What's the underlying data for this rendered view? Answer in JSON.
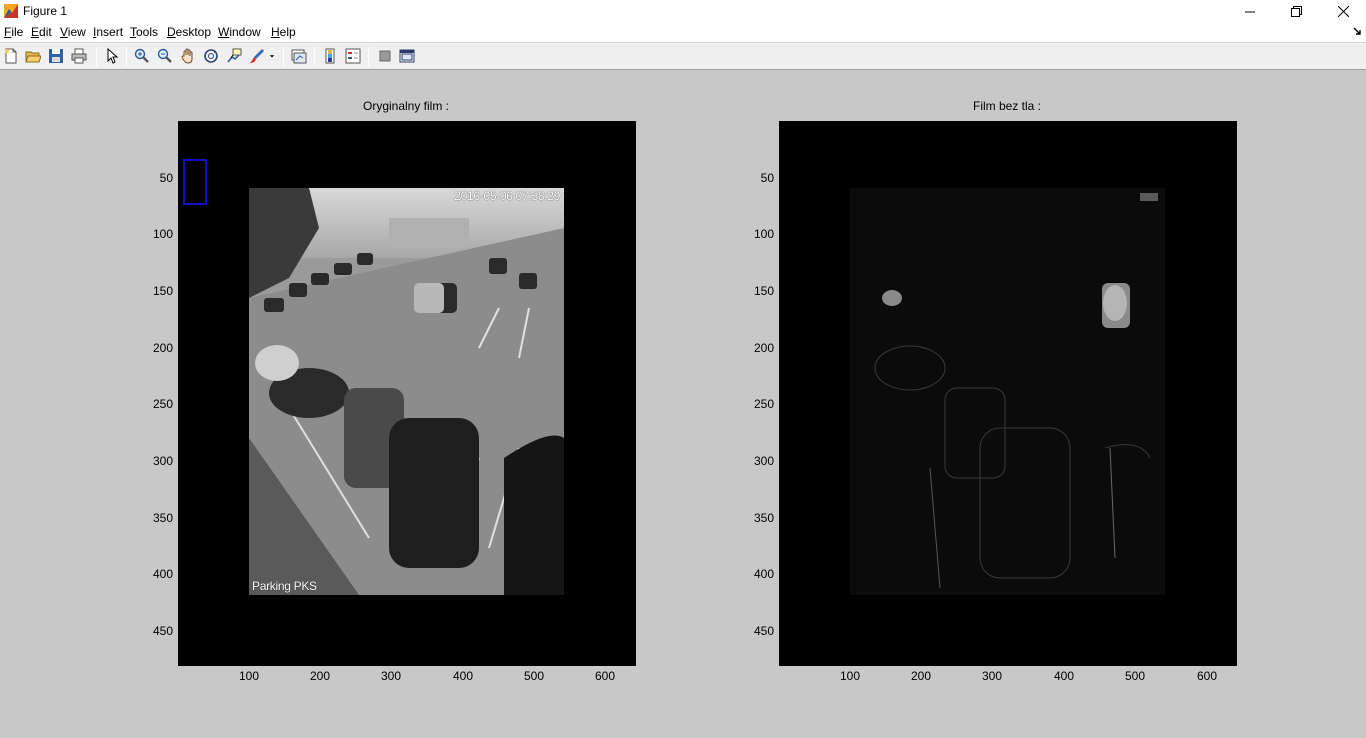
{
  "window": {
    "title": "Figure 1"
  },
  "menu": [
    "File",
    "Edit",
    "View",
    "Insert",
    "Tools",
    "Desktop",
    "Window",
    "Help"
  ],
  "toolbar": {
    "buttons": [
      "new-figure-icon",
      "open-file-icon",
      "save-icon",
      "print-icon",
      "edit-plot-arrow-icon",
      "zoom-in-icon",
      "zoom-out-icon",
      "pan-hand-icon",
      "rotate-3d-icon",
      "data-cursor-icon",
      "brush-icon",
      "link-plot-icon",
      "colorbar-icon",
      "legend-icon",
      "hide-plot-tools-icon",
      "show-plot-tools-icon"
    ]
  },
  "axes_left": {
    "title": "Oryginalny film :",
    "yticks": [
      "50",
      "100",
      "150",
      "200",
      "250",
      "300",
      "350",
      "400",
      "450"
    ],
    "xticks": [
      "100",
      "200",
      "300",
      "400",
      "500",
      "600"
    ],
    "timestamp": "2016-05-06 07:58:29",
    "caption": "Parking PKS"
  },
  "axes_right": {
    "title": "Film bez tla :",
    "yticks": [
      "50",
      "100",
      "150",
      "200",
      "250",
      "300",
      "350",
      "400",
      "450"
    ],
    "xticks": [
      "100",
      "200",
      "300",
      "400",
      "500",
      "600"
    ]
  },
  "colors": {
    "bbox": "#1010c8",
    "figure_bg": "#c8c8c8",
    "axes_bg": "#000000"
  }
}
